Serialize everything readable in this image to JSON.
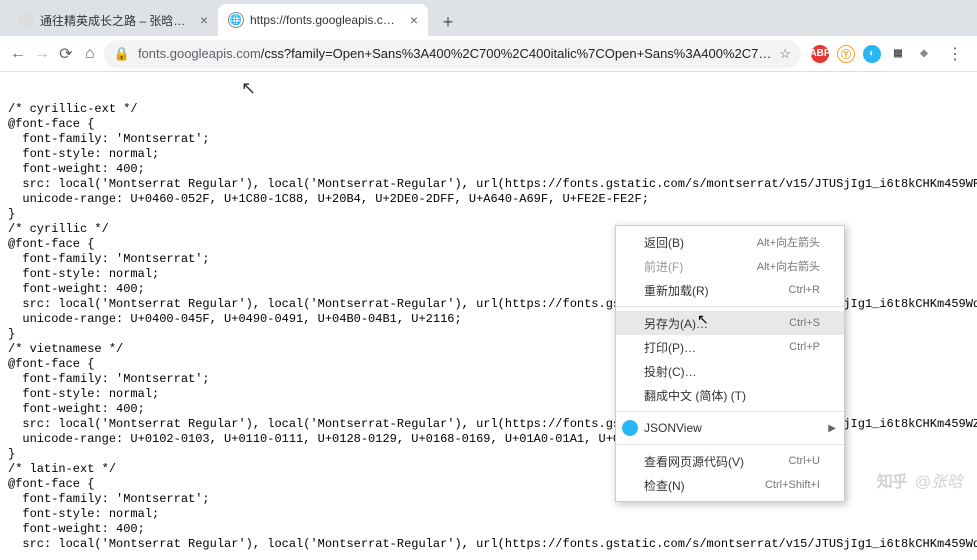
{
  "tabs": [
    {
      "title": "通往精英成长之路 – 张晗一致力",
      "favicon_bg": "#eee",
      "favicon_text": ""
    },
    {
      "title": "https://fonts.googleapis.com/",
      "favicon_bg": "#fff",
      "favicon_text": ""
    }
  ],
  "address_bar": {
    "protocol_dim": "fonts.googleapis.com",
    "path": "/css?family=Open+Sans%3A400%2C700%2C400italic%7COpen+Sans%3A400%2C7…"
  },
  "ext": {
    "abp": "ABP"
  },
  "css_code": "/* cyrillic-ext */\n@font-face {\n  font-family: 'Montserrat';\n  font-style: normal;\n  font-weight: 400;\n  src: local('Montserrat Regular'), local('Montserrat-Regular'), url(https://fonts.gstatic.com/s/montserrat/v15/JTUSjIg1_i6t8kCHKm459WRhyzbi.woff2) format('\n  unicode-range: U+0460-052F, U+1C80-1C88, U+20B4, U+2DE0-2DFF, U+A640-A69F, U+FE2E-FE2F;\n}\n/* cyrillic */\n@font-face {\n  font-family: 'Montserrat';\n  font-style: normal;\n  font-weight: 400;\n  src: local('Montserrat Regular'), local('Montserrat-Regular'), url(https://fonts.gstatic.com/s/montserrat/v15/JTUSjIg1_i6t8kCHKm459Wdhyzbi.woff2) format('\n  unicode-range: U+0400-045F, U+0490-0491, U+04B0-04B1, U+2116;\n}\n/* vietnamese */\n@font-face {\n  font-family: 'Montserrat';\n  font-style: normal;\n  font-weight: 400;\n  src: local('Montserrat Regular'), local('Montserrat-Regular'), url(https://fonts.gstatic.com/s/montserrat/v15/JTUSjIg1_i6t8kCHKm459WZhyzbi.woff2) format('\n  unicode-range: U+0102-0103, U+0110-0111, U+0128-0129, U+0168-0169, U+01A0-01A1, U+01AF-01B0, U+\n}\n/* latin-ext */\n@font-face {\n  font-family: 'Montserrat';\n  font-style: normal;\n  font-weight: 400;\n  src: local('Montserrat Regular'), local('Montserrat-Regular'), url(https://fonts.gstatic.com/s/montserrat/v15/JTUSjIg1_i6t8kCHKm459Wdhyzbi.woff2) format('",
  "context_menu": {
    "back": {
      "label": "返回(B)",
      "shortcut": "Alt+向左箭头"
    },
    "forward": {
      "label": "前进(F)",
      "shortcut": "Alt+向右箭头"
    },
    "reload": {
      "label": "重新加载(R)",
      "shortcut": "Ctrl+R"
    },
    "save_as": {
      "label": "另存为(A)…",
      "shortcut": "Ctrl+S"
    },
    "print": {
      "label": "打印(P)…",
      "shortcut": "Ctrl+P"
    },
    "cast": {
      "label": "投射(C)…",
      "shortcut": ""
    },
    "translate": {
      "label": "翻成中文 (简体) (T)",
      "shortcut": ""
    },
    "jsonview": {
      "label": "JSONView",
      "shortcut": ""
    },
    "source": {
      "label": "查看网页源代码(V)",
      "shortcut": "Ctrl+U"
    },
    "inspect": {
      "label": "检查(N)",
      "shortcut": "Ctrl+Shift+I"
    }
  },
  "watermark": {
    "logo": "知乎",
    "author": "@张晗"
  }
}
